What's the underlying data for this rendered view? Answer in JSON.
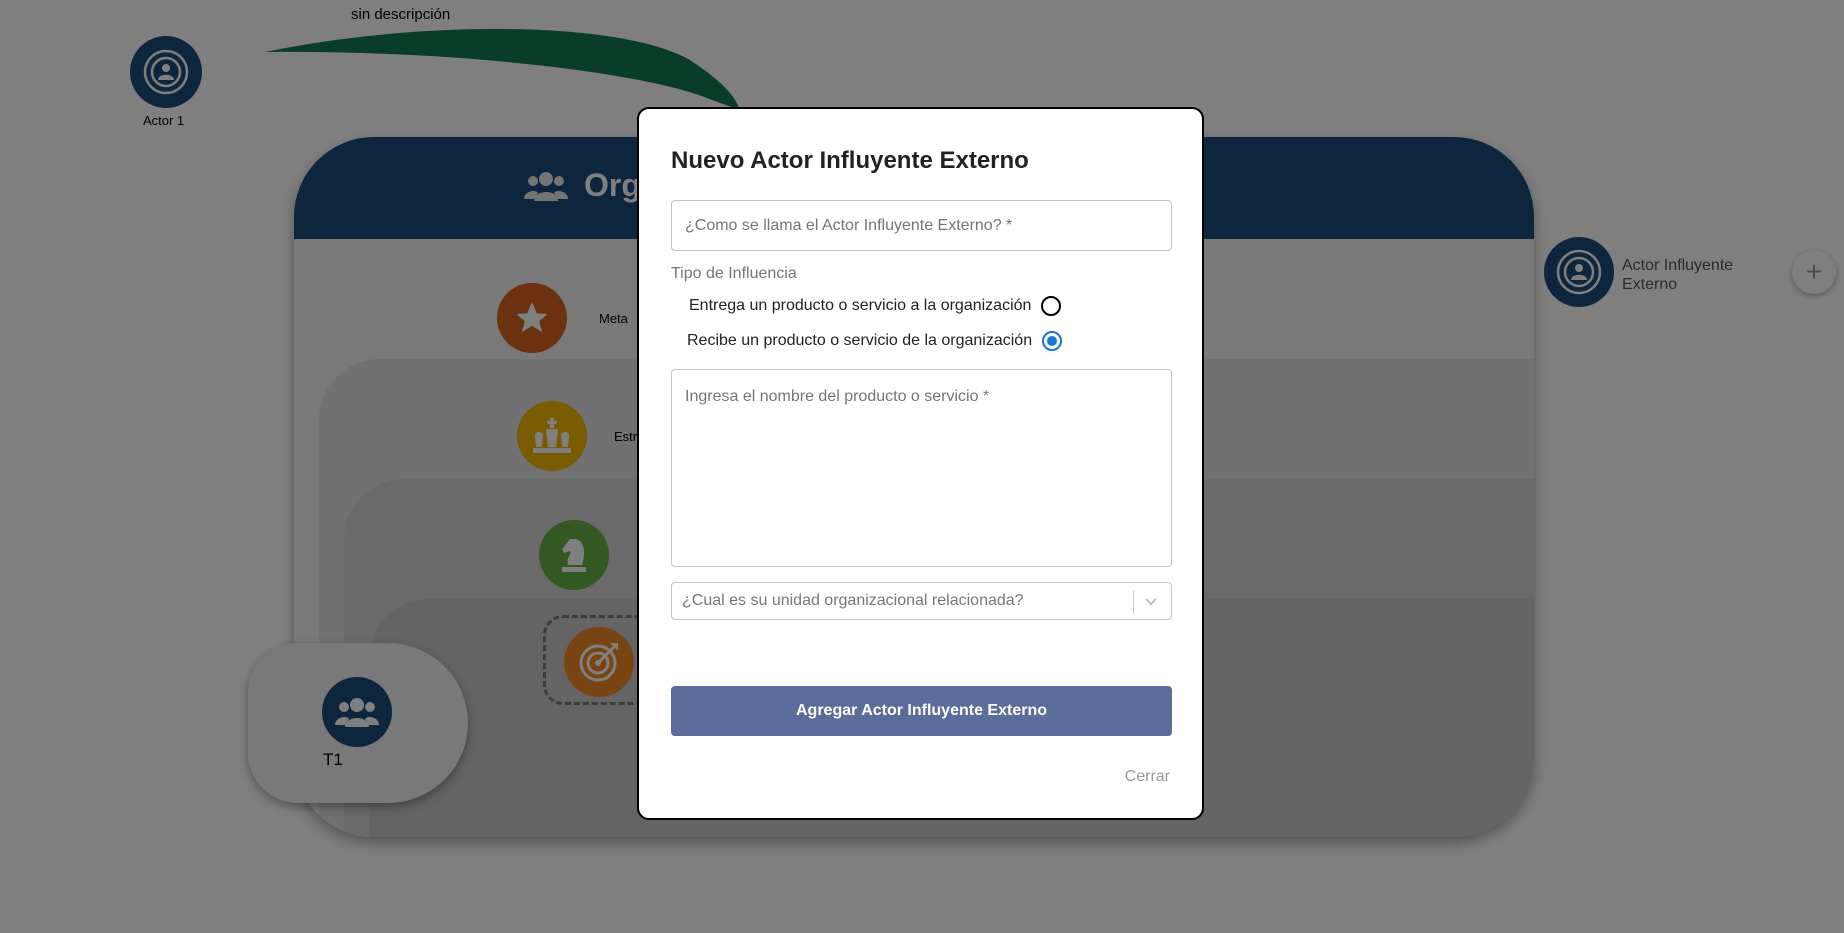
{
  "canvas": {
    "edge_label": "sin descripción",
    "actor1_label": "Actor 1",
    "org_title": "Organiz",
    "meta_label": "Meta",
    "estrategia_label": "Estra",
    "team_label": "T1",
    "external_actor_label": "Actor Influyente Externo",
    "plus_label": "+",
    "colors": {
      "header_blue": "#1b4a7a",
      "meta_orange": "#d9621c",
      "estrategia_yellow": "#f2b705",
      "knight_green": "#67b045",
      "target_orange": "#f08a24",
      "arrow_green": "#137a52"
    },
    "icons": [
      "radar-person-icon",
      "users-icon",
      "star-icon",
      "chess-king-icon",
      "chess-knight-icon",
      "target-icon",
      "plus-icon"
    ]
  },
  "modal": {
    "title": "Nuevo Actor Influyente Externo",
    "name_placeholder": "¿Como se llama el Actor Influyente Externo? *",
    "influence_group_label": "Tipo de Influencia",
    "radio_options": [
      {
        "label": "Entrega un producto o servicio a la organización",
        "checked": false
      },
      {
        "label": "Recibe un producto o servicio de la organización",
        "checked": true
      }
    ],
    "product_placeholder": "Ingresa el nombre del producto o servicio *",
    "unit_placeholder": "¿Cual es su unidad organizacional relacionada?",
    "submit_label": "Agregar Actor Influyente Externo",
    "close_label": "Cerrar",
    "colors": {
      "submit_bg": "#5b6b9a",
      "radio_checked": "#1976d2"
    }
  }
}
